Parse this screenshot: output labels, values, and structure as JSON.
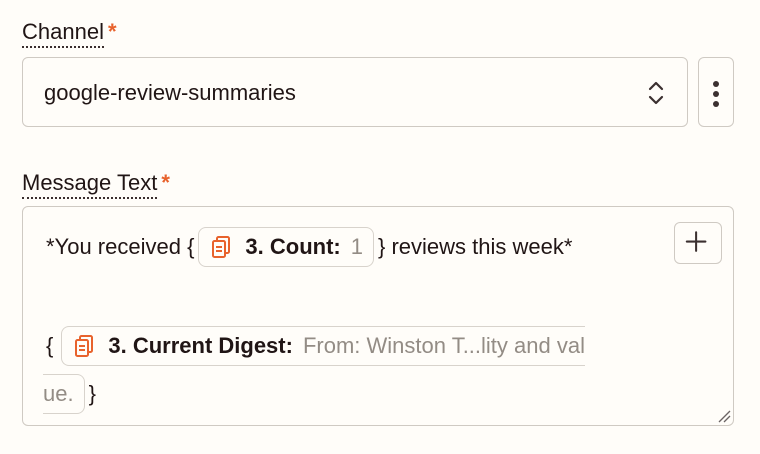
{
  "channel": {
    "label": "Channel",
    "required_mark": "*",
    "selected_value": "google-review-summaries"
  },
  "message": {
    "label": "Message Text",
    "required_mark": "*",
    "line1_prefix": "*You received {",
    "count_pill": {
      "key": "3. Count:",
      "value": "1"
    },
    "line1_suffix": "} reviews this week*",
    "line2_prefix": "{",
    "digest_pill": {
      "key": "3. Current Digest:",
      "value": "From: Winston T...lity and val",
      "value_continued": "ue."
    },
    "line3_suffix": "}"
  },
  "colors": {
    "accent": "#e8622c",
    "border": "#cfcac3",
    "background": "#fffdf9",
    "text": "#201515",
    "muted": "#938c85"
  },
  "icons": {
    "chevrons": "chevron-up-down-icon",
    "more": "vertical-dots-icon",
    "plus": "plus-icon",
    "pill": "document-stack-icon",
    "resize": "resize-handle-icon"
  }
}
